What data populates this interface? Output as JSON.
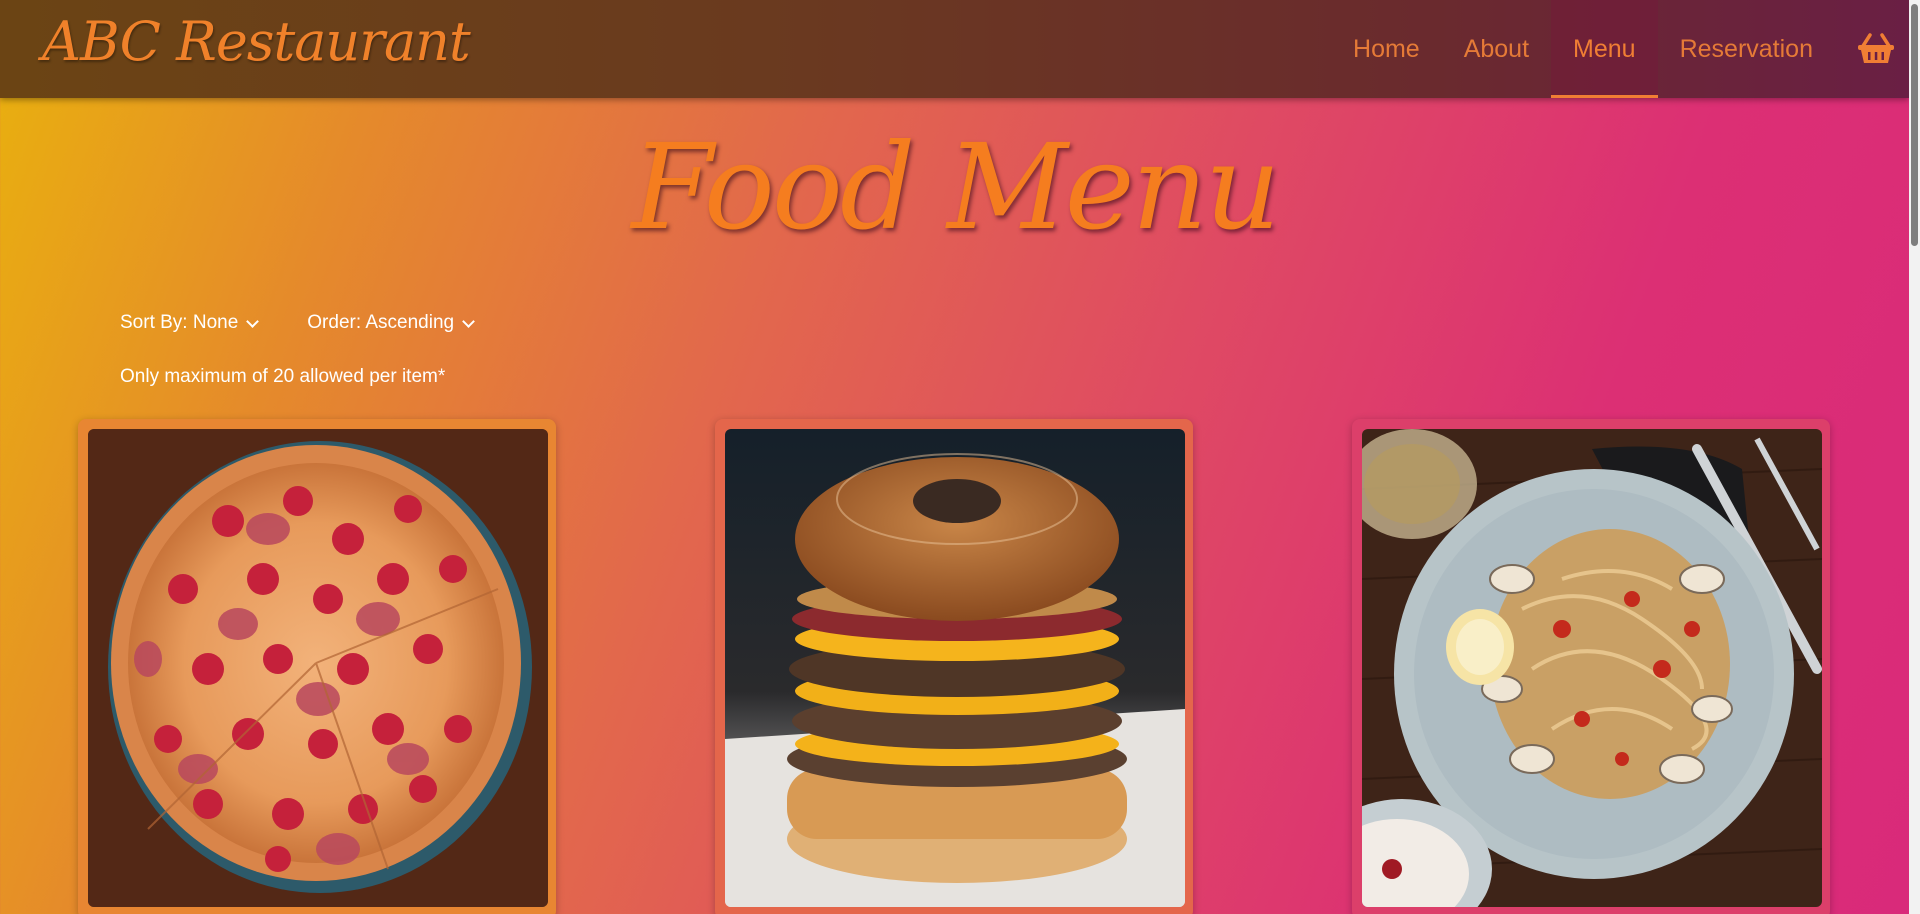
{
  "nav": {
    "brand": "ABC Restaurant",
    "items": [
      {
        "label": "Home",
        "active": false
      },
      {
        "label": "About",
        "active": false
      },
      {
        "label": "Menu",
        "active": true
      },
      {
        "label": "Reservation",
        "active": false
      }
    ],
    "cart_icon": "basket-icon"
  },
  "page": {
    "title": "Food Menu"
  },
  "controls": {
    "sort_label": "Sort By: None",
    "order_label": "Order: Ascending"
  },
  "note": "Only maximum of 20 allowed per item*",
  "items": [
    {
      "image": "pepperoni-pizza-photo"
    },
    {
      "image": "donut-cheeseburger-photo"
    },
    {
      "image": "clam-pasta-photo"
    }
  ],
  "colors": {
    "accent": "#f07e34",
    "nav_background": "#6a3a1f"
  }
}
